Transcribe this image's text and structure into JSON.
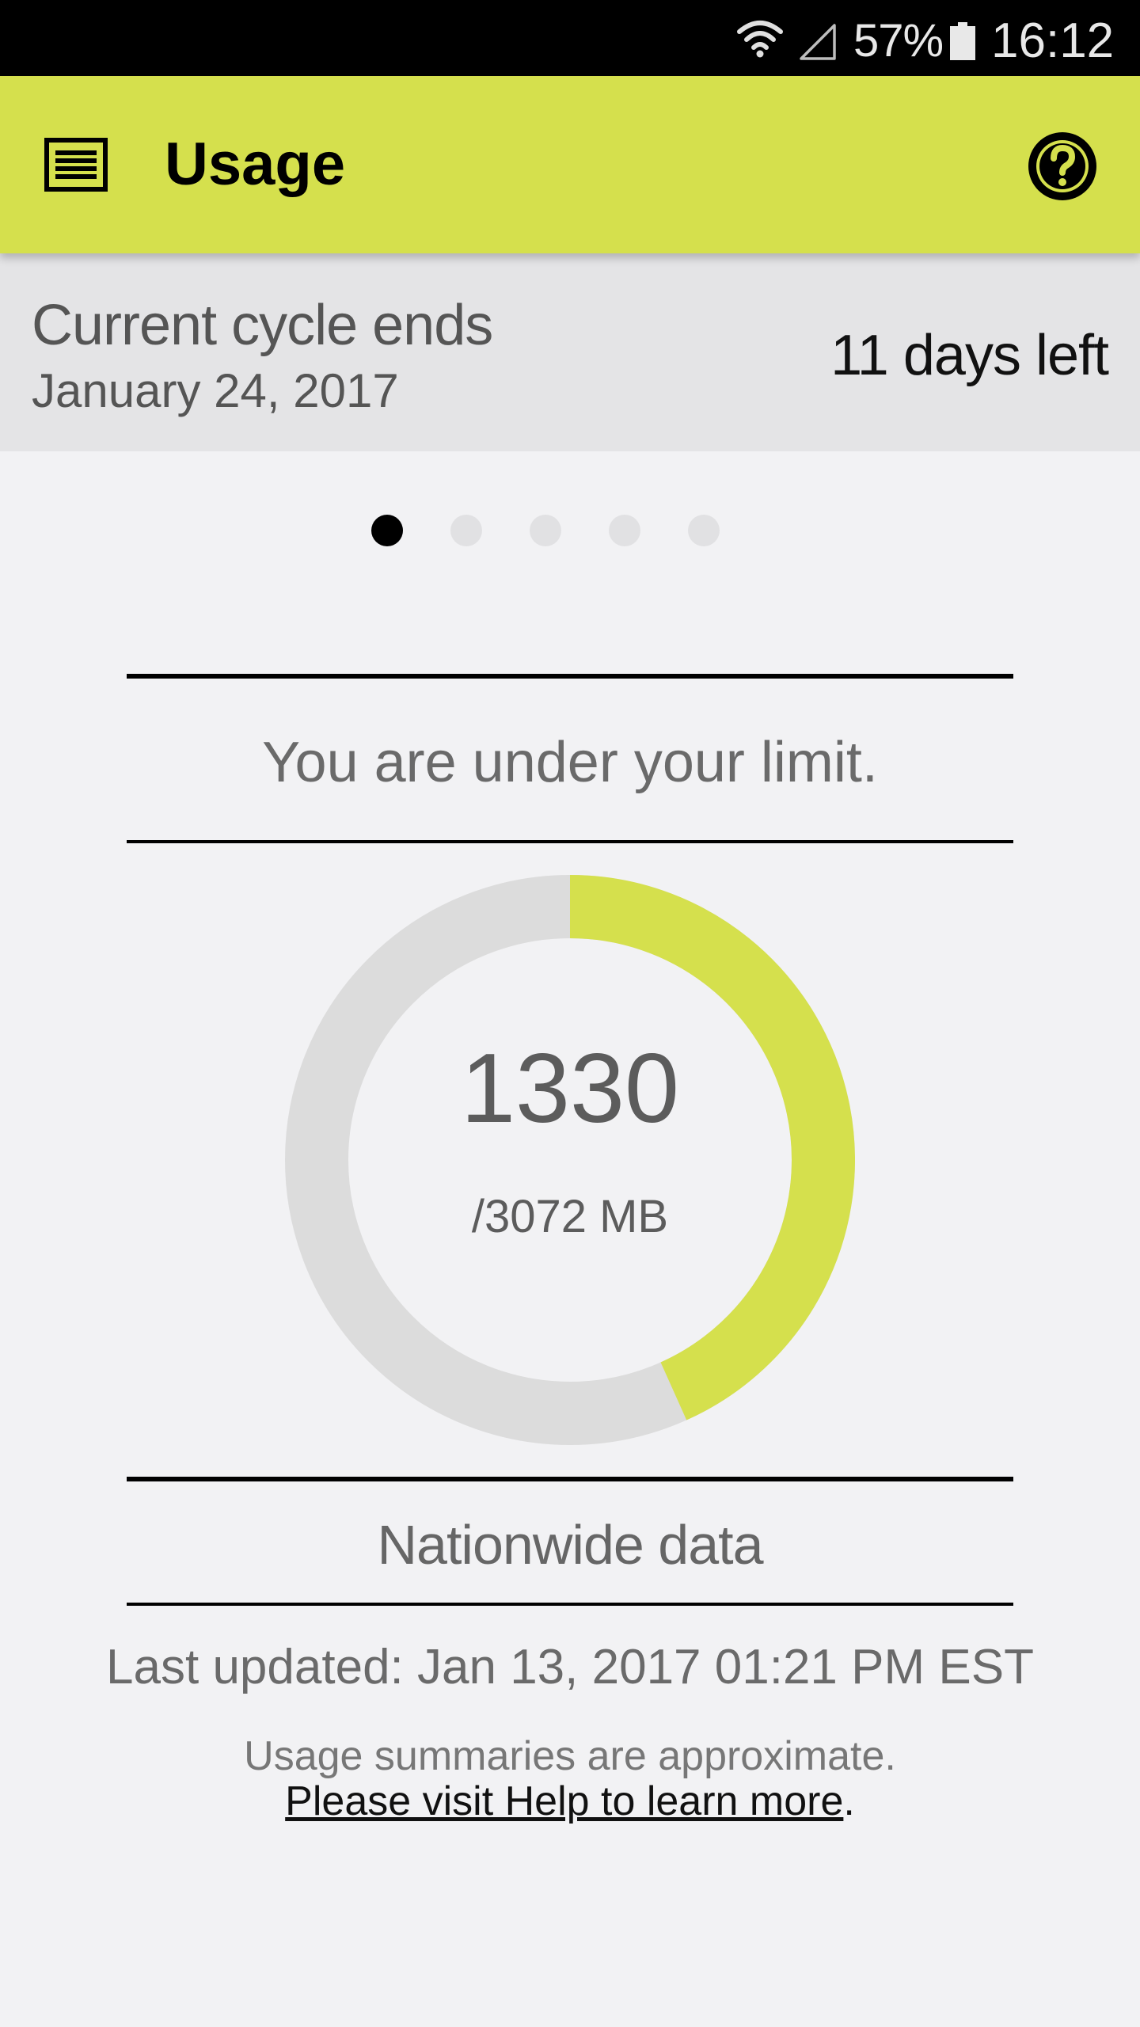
{
  "status_bar": {
    "battery_percent": "57%",
    "time": "16:12",
    "icons": [
      "wifi-icon",
      "signal-icon",
      "battery-icon"
    ]
  },
  "app_bar": {
    "title": "Usage",
    "menu_icon": "menu-icon",
    "help_icon": "help-icon",
    "background_color": "#d5e04d"
  },
  "cycle": {
    "title": "Current cycle ends",
    "end_date": "January 24, 2017",
    "days_left": "11 days left"
  },
  "pager": {
    "page_count": 5,
    "active_index": 0
  },
  "usage": {
    "status_message": "You are under your limit.",
    "used": "1330",
    "limit_text": "/3072 MB",
    "used_mb": 1330,
    "limit_mb": 3072,
    "data_type": "Nationwide data",
    "ring_used_color": "#d5e04d",
    "ring_remaining_color": "#dcdcdc"
  },
  "footer": {
    "last_updated": "Last updated: Jan 13, 2017 01:21 PM EST",
    "disclaimer": "Usage summaries are approximate.",
    "help_link": "Please visit Help to learn more",
    "help_suffix": "."
  }
}
